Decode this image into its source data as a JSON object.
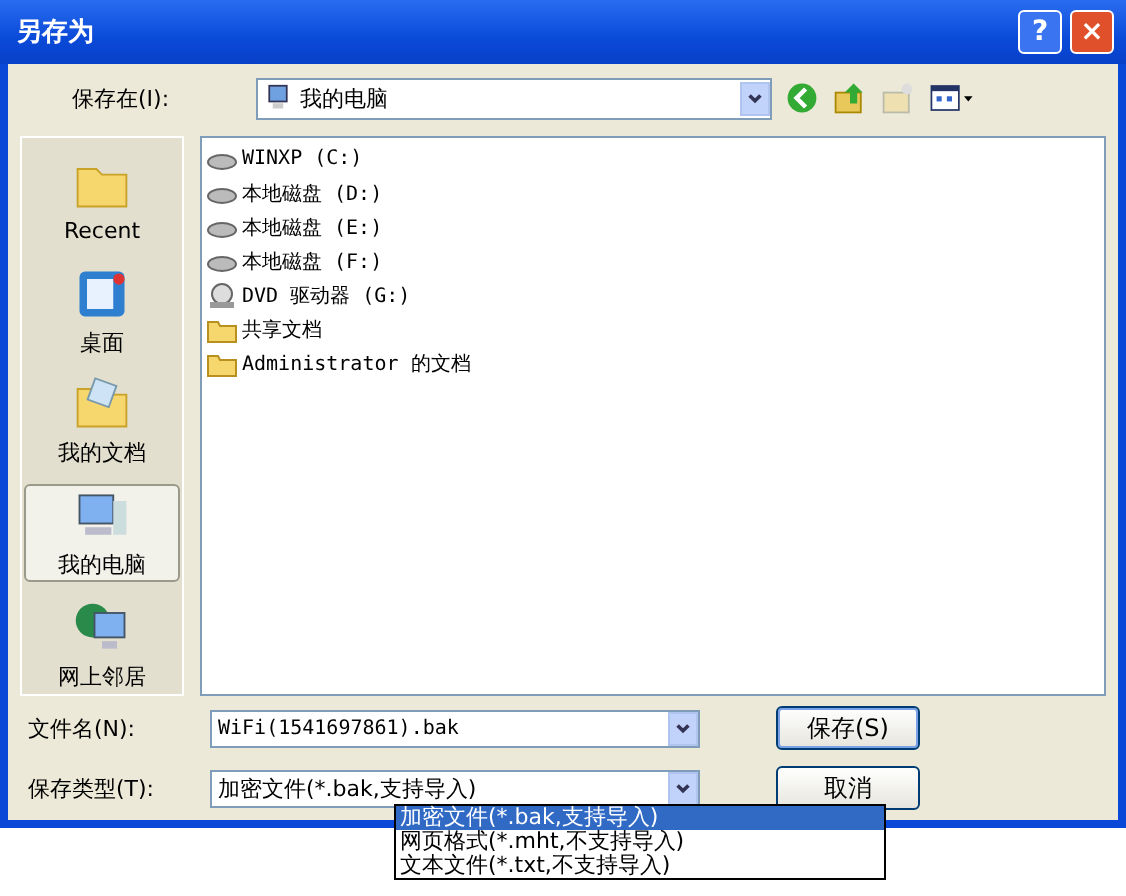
{
  "window": {
    "title": "另存为",
    "buttons": [
      "?",
      "×"
    ]
  },
  "location": {
    "label": "保存在(I):",
    "value": "我的电脑"
  },
  "places": [
    {
      "label": "Recent",
      "kind": "recent",
      "selected": false
    },
    {
      "label": "桌面",
      "kind": "desktop",
      "selected": false
    },
    {
      "label": "我的文档",
      "kind": "documents",
      "selected": false
    },
    {
      "label": "我的电脑",
      "kind": "computer",
      "selected": true
    },
    {
      "label": "网上邻居",
      "kind": "network",
      "selected": false
    }
  ],
  "files": [
    {
      "name": "WINXP (C:)",
      "kind": "drive"
    },
    {
      "name": "本地磁盘 (D:)",
      "kind": "drive"
    },
    {
      "name": "本地磁盘 (E:)",
      "kind": "drive"
    },
    {
      "name": "本地磁盘 (F:)",
      "kind": "drive"
    },
    {
      "name": "DVD 驱动器 (G:)",
      "kind": "dvd"
    },
    {
      "name": "共享文档",
      "kind": "folder"
    },
    {
      "name": "Administrator 的文档",
      "kind": "folder"
    }
  ],
  "filename": {
    "label": "文件名(N):",
    "value": "WiFi(1541697861).bak"
  },
  "filetype": {
    "label": "保存类型(T):",
    "value": "加密文件(*.bak,支持导入)",
    "options": [
      {
        "label": "加密文件(*.bak,支持导入)",
        "selected": true
      },
      {
        "label": "网页格式(*.mht,不支持导入)",
        "selected": false
      },
      {
        "label": "文本文件(*.txt,不支持导入)",
        "selected": false
      }
    ]
  },
  "actions": [
    "保存(S)",
    "取消"
  ]
}
